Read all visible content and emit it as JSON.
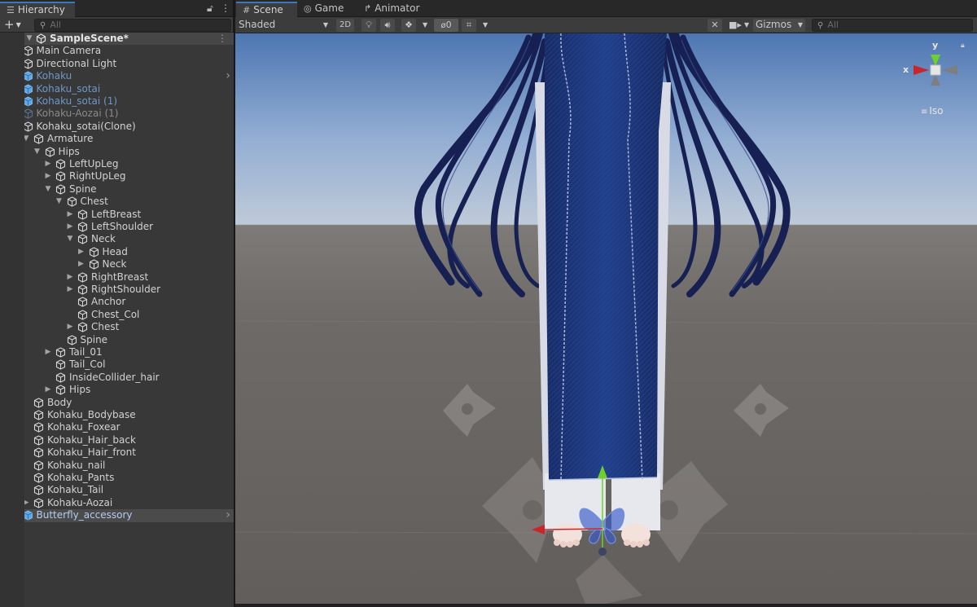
{
  "hierarchy": {
    "tab_label": "Hierarchy",
    "add_label": "+",
    "search_placeholder": "All",
    "scene_name": "SampleScene*",
    "items": [
      {
        "label": "Main Camera",
        "depth": 1,
        "arrow": "",
        "style": "normal"
      },
      {
        "label": "Directional Light",
        "depth": 1,
        "arrow": "",
        "style": "normal"
      },
      {
        "label": "Kohaku",
        "depth": 1,
        "arrow": "right",
        "style": "blue",
        "more": true
      },
      {
        "label": "Kohaku_sotai",
        "depth": 1,
        "arrow": "right",
        "style": "blue"
      },
      {
        "label": "Kohaku_sotai (1)",
        "depth": 1,
        "arrow": "right",
        "style": "blue"
      },
      {
        "label": "Kohaku-Aozai (1)",
        "depth": 1,
        "arrow": "right",
        "style": "dim"
      },
      {
        "label": "Kohaku_sotai(Clone)",
        "depth": 1,
        "arrow": "down",
        "style": "normal"
      },
      {
        "label": "Armature",
        "depth": 2,
        "arrow": "down",
        "style": "normal"
      },
      {
        "label": "Hips",
        "depth": 3,
        "arrow": "down",
        "style": "normal"
      },
      {
        "label": "LeftUpLeg",
        "depth": 4,
        "arrow": "right",
        "style": "normal"
      },
      {
        "label": "RightUpLeg",
        "depth": 4,
        "arrow": "right",
        "style": "normal"
      },
      {
        "label": "Spine",
        "depth": 4,
        "arrow": "down",
        "style": "normal"
      },
      {
        "label": "Chest",
        "depth": 5,
        "arrow": "down",
        "style": "normal"
      },
      {
        "label": "LeftBreast",
        "depth": 6,
        "arrow": "right",
        "style": "normal"
      },
      {
        "label": "LeftShoulder",
        "depth": 6,
        "arrow": "right",
        "style": "normal"
      },
      {
        "label": "Neck",
        "depth": 6,
        "arrow": "down",
        "style": "normal"
      },
      {
        "label": "Head",
        "depth": 7,
        "arrow": "right",
        "style": "normal"
      },
      {
        "label": "Neck",
        "depth": 7,
        "arrow": "right",
        "style": "normal"
      },
      {
        "label": "RightBreast",
        "depth": 6,
        "arrow": "right",
        "style": "normal"
      },
      {
        "label": "RightShoulder",
        "depth": 6,
        "arrow": "right",
        "style": "normal"
      },
      {
        "label": "Anchor",
        "depth": 6,
        "arrow": "",
        "style": "normal"
      },
      {
        "label": "Chest_Col",
        "depth": 6,
        "arrow": "",
        "style": "normal"
      },
      {
        "label": "Chest",
        "depth": 6,
        "arrow": "right",
        "style": "normal"
      },
      {
        "label": "Spine",
        "depth": 5,
        "arrow": "",
        "style": "normal"
      },
      {
        "label": "Tail_01",
        "depth": 4,
        "arrow": "right",
        "style": "normal"
      },
      {
        "label": "Tail_Col",
        "depth": 4,
        "arrow": "",
        "style": "normal"
      },
      {
        "label": "InsideCollider_hair",
        "depth": 4,
        "arrow": "",
        "style": "normal"
      },
      {
        "label": "Hips",
        "depth": 4,
        "arrow": "right",
        "style": "normal"
      },
      {
        "label": "Body",
        "depth": 2,
        "arrow": "",
        "style": "normal"
      },
      {
        "label": "Kohaku_Bodybase",
        "depth": 2,
        "arrow": "",
        "style": "normal"
      },
      {
        "label": "Kohaku_Foxear",
        "depth": 2,
        "arrow": "",
        "style": "normal"
      },
      {
        "label": "Kohaku_Hair_back",
        "depth": 2,
        "arrow": "",
        "style": "normal"
      },
      {
        "label": "Kohaku_Hair_front",
        "depth": 2,
        "arrow": "",
        "style": "normal"
      },
      {
        "label": "Kohaku_nail",
        "depth": 2,
        "arrow": "",
        "style": "normal"
      },
      {
        "label": "Kohaku_Pants",
        "depth": 2,
        "arrow": "",
        "style": "normal"
      },
      {
        "label": "Kohaku_Tail",
        "depth": 2,
        "arrow": "",
        "style": "normal"
      },
      {
        "label": "Kohaku-Aozai",
        "depth": 2,
        "arrow": "right",
        "style": "normal"
      },
      {
        "label": "Butterfly_accessory",
        "depth": 1,
        "arrow": "right",
        "style": "prefab-highlight",
        "more": true
      }
    ]
  },
  "tabs": {
    "scene": "Scene",
    "game": "Game",
    "animator": "Animator"
  },
  "scene_toolbar": {
    "shading_mode": "Shaded",
    "mode_2d": "2D",
    "hidden_count": "0",
    "gizmos_label": "Gizmos",
    "search_placeholder": "All"
  },
  "orientation_gizmo": {
    "x_label": "x",
    "y_label": "y",
    "projection": "Iso"
  },
  "colors": {
    "active_tab_accent": "#3a79bb",
    "gizmo_x": "#c8262b",
    "gizmo_y": "#6fd02a",
    "dress_blue": "#1b3578",
    "hair_navy": "#161d45"
  }
}
